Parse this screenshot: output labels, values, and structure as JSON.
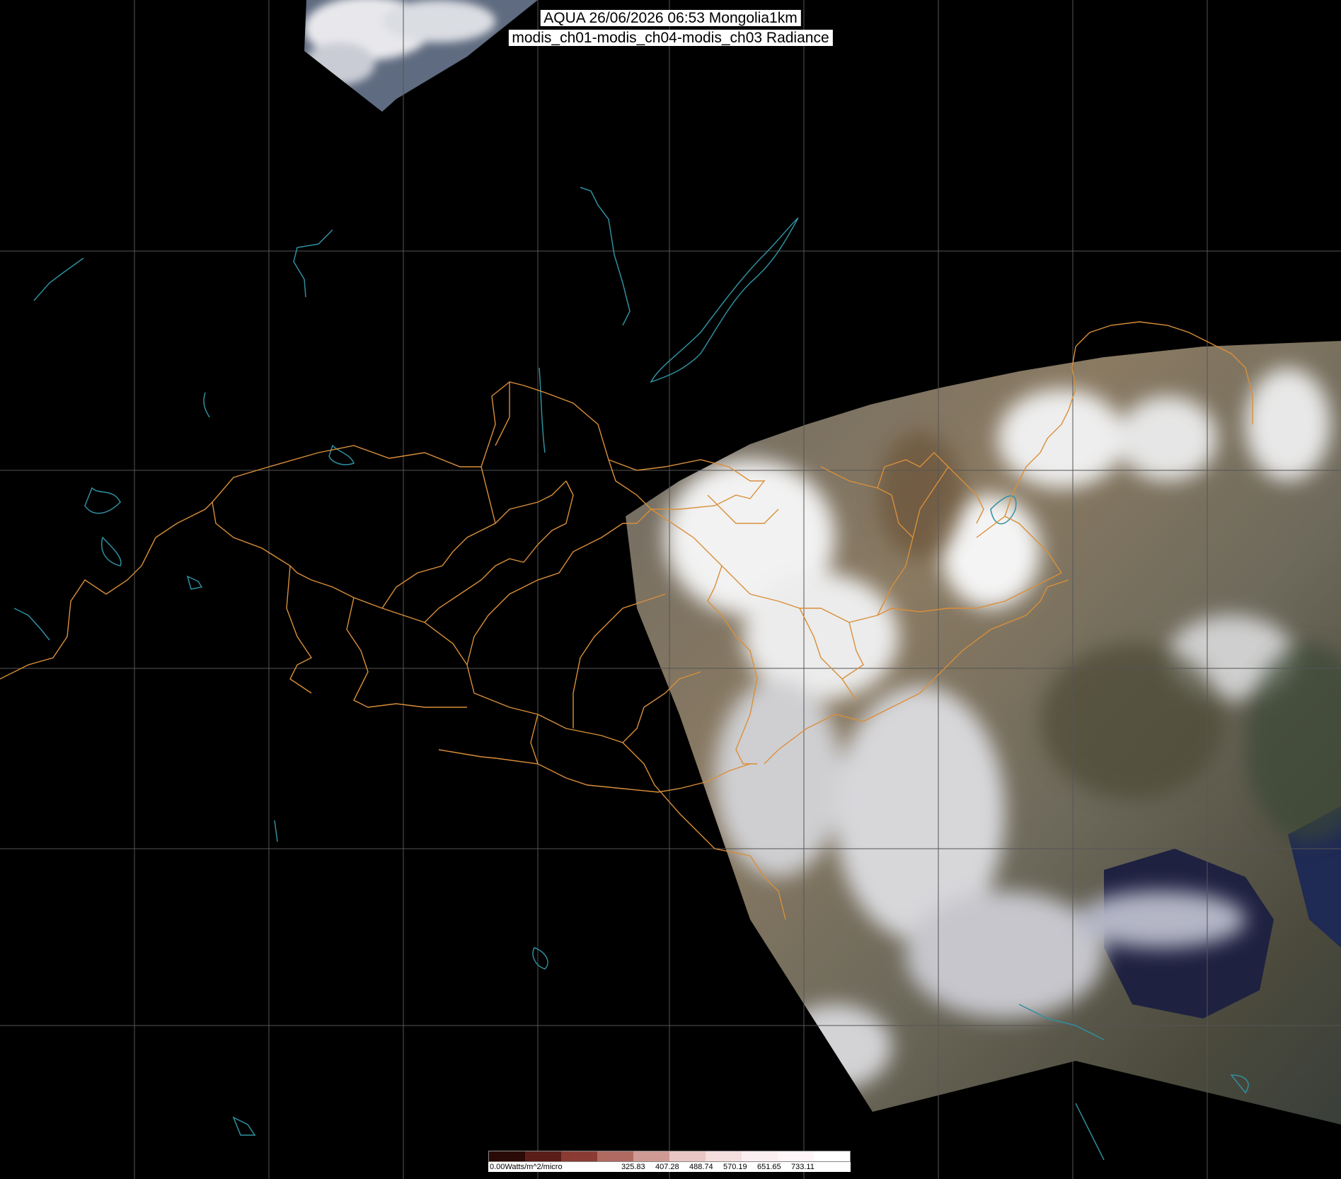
{
  "title": {
    "line1": "AQUA 26/06/2026 06:53 Mongolia1km",
    "line2": "modis_ch01-modis_ch04-modis_ch03 Radiance"
  },
  "colorbar": {
    "unit_label": "0.00Watts/m^2/micro",
    "ticks": [
      "325.83",
      "407.28",
      "488.74",
      "570.19",
      "651.65",
      "733.11"
    ],
    "colors": [
      "#2a0a06",
      "#5a1e18",
      "#8a3c34",
      "#b06a62",
      "#cf9a94",
      "#e9c6c3",
      "#f5dede",
      "#fbeef0",
      "#fff4f8",
      "#ffffff"
    ]
  },
  "map": {
    "background": "#000000",
    "graticule_color": "#555555",
    "border_color": "#d98f3a",
    "coast_color": "#2f8fa0"
  }
}
